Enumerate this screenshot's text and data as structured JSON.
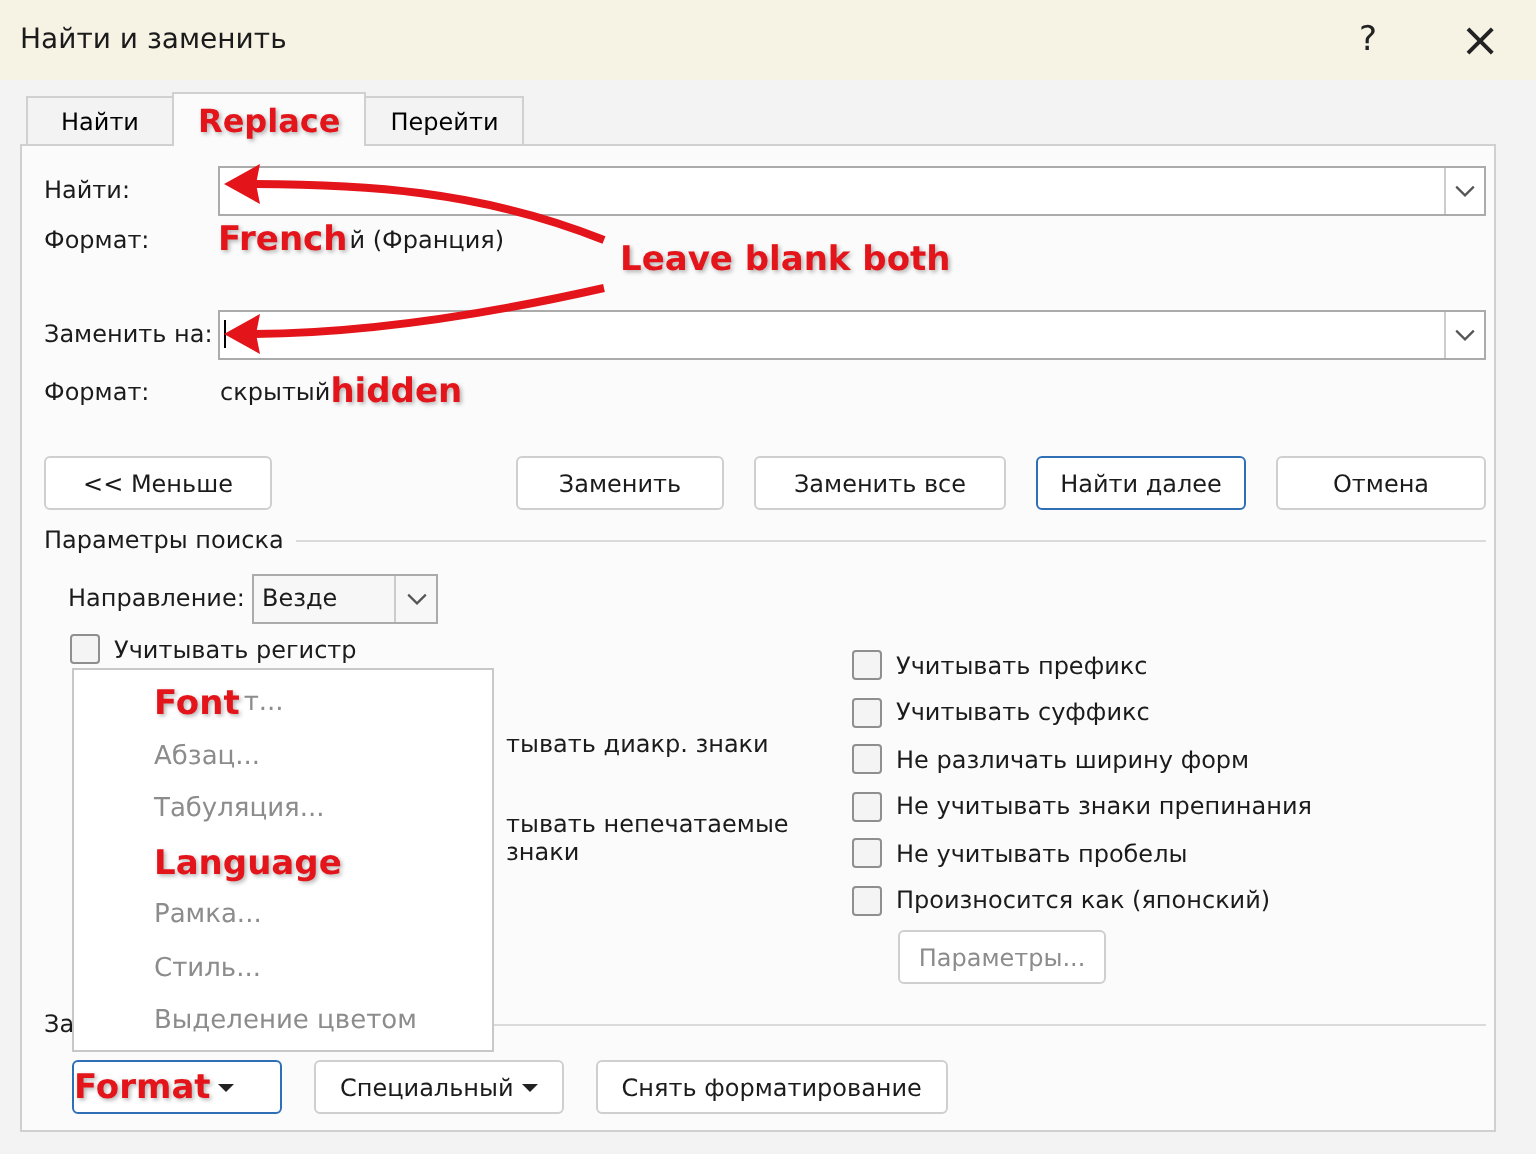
{
  "window": {
    "title": "Найти и заменить",
    "help": "?",
    "close": "×"
  },
  "tabs": [
    {
      "label": "Найти",
      "selected": false,
      "annotated": false
    },
    {
      "label": "Replace",
      "selected": true,
      "annotated": true
    },
    {
      "label": "Перейти",
      "selected": false,
      "annotated": false
    }
  ],
  "find": {
    "label": "Найти:",
    "format_label": "Формат:",
    "format_annotation": "French",
    "format_value": "й (Франция)"
  },
  "replace": {
    "label": "Заменить на:",
    "format_label": "Формат:",
    "format_value": "скрытый",
    "format_annotation": "hidden"
  },
  "annotation": {
    "text": "Leave blank both"
  },
  "buttons": [
    {
      "label": "<< Меньше",
      "default": false
    },
    {
      "label": "Заменить",
      "default": false
    },
    {
      "label": "Заменить все",
      "default": false
    },
    {
      "label": "Найти далее",
      "default": true
    },
    {
      "label": "Отмена",
      "default": false
    }
  ],
  "search_options": {
    "title": "Параметры поиска",
    "direction_label": "Направление:",
    "direction_value": "Везде",
    "left": [
      {
        "kind": "checkbox",
        "label": "Учитывать регистр",
        "checked": false
      },
      {
        "kind": "fragment",
        "label": "тывать диакр. знаки"
      },
      {
        "kind": "fragment",
        "label": "тывать непечатаемые знаки"
      }
    ],
    "right": [
      {
        "label": "Учитывать префикс",
        "checked": false
      },
      {
        "label": "Учитывать суффикс",
        "checked": false
      },
      {
        "label": "Не различать ширину форм",
        "checked": false
      },
      {
        "label": "Не учитывать знаки препинания",
        "checked": false
      },
      {
        "label": "Не учитывать пробелы",
        "checked": false
      },
      {
        "label": "Произносится как (японский)",
        "checked": false
      }
    ],
    "params_button": {
      "label": "Параметры...",
      "disabled": true
    }
  },
  "replace_section": {
    "label": "За"
  },
  "format_menu": [
    {
      "annotation": "Font",
      "label": "т...",
      "disabled": true
    },
    {
      "label": "Абзац...",
      "disabled": true
    },
    {
      "label": "Табуляция...",
      "disabled": true
    },
    {
      "annotation": "Language",
      "disabled": true
    },
    {
      "label": "Рамка...",
      "disabled": true
    },
    {
      "label": "Стиль...",
      "disabled": true
    },
    {
      "label": "Выделение цветом",
      "disabled": true
    }
  ],
  "bottom_buttons": [
    {
      "kind": "annotated_dropdown",
      "label": "Format",
      "focused": true
    },
    {
      "kind": "dropdown",
      "label": "Специальный",
      "focused": false
    },
    {
      "kind": "plain",
      "label": "Снять форматирование",
      "focused": false
    }
  ]
}
